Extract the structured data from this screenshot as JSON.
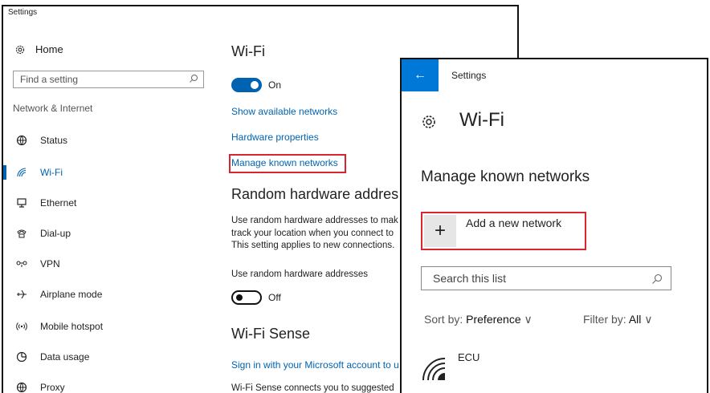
{
  "back_window": {
    "title": "Settings",
    "sidebar": {
      "home_label": "Home",
      "search_placeholder": "Find a setting",
      "section_label": "Network & Internet",
      "items": [
        {
          "label": "Status",
          "icon": "globe-icon"
        },
        {
          "label": "Wi-Fi",
          "icon": "wifi-icon",
          "active": true
        },
        {
          "label": "Ethernet",
          "icon": "ethernet-icon"
        },
        {
          "label": "Dial-up",
          "icon": "phone-icon"
        },
        {
          "label": "VPN",
          "icon": "vpn-icon"
        },
        {
          "label": "Airplane mode",
          "icon": "airplane-icon"
        },
        {
          "label": "Mobile hotspot",
          "icon": "hotspot-icon"
        },
        {
          "label": "Data usage",
          "icon": "data-usage-icon"
        },
        {
          "label": "Proxy",
          "icon": "globe-icon"
        }
      ]
    },
    "main": {
      "heading": "Wi-Fi",
      "wifi_toggle_label": "On",
      "links": {
        "show_networks": "Show available networks",
        "hardware_properties": "Hardware properties",
        "manage_known": "Manage known networks"
      },
      "random_hw_heading": "Random hardware addres",
      "random_hw_text": [
        "Use random hardware addresses to mak",
        "track your location when you connect to",
        "This setting applies to new connections."
      ],
      "random_hw_toggle_caption": "Use random hardware addresses",
      "random_hw_toggle_label": "Off",
      "wifi_sense_heading": "Wi-Fi Sense",
      "wifi_sense_link": "Sign in with your Microsoft account to u",
      "wifi_sense_text": "Wi-Fi Sense connects you to suggested"
    }
  },
  "front_window": {
    "title": "Settings",
    "back_glyph": "←",
    "heading": "Wi-Fi",
    "subheading": "Manage known networks",
    "add_network_label": "Add a new network",
    "add_glyph": "+",
    "search_placeholder": "Search this list",
    "sort_prefix": "Sort by:",
    "sort_value": "Preference",
    "filter_prefix": "Filter by:",
    "filter_value": "All",
    "chevron": "∨",
    "networks": [
      {
        "name": "ECU"
      }
    ]
  },
  "colors": {
    "accent": "#0063b1",
    "titlebar_accent": "#0078d7",
    "highlight": "#d9262e"
  }
}
